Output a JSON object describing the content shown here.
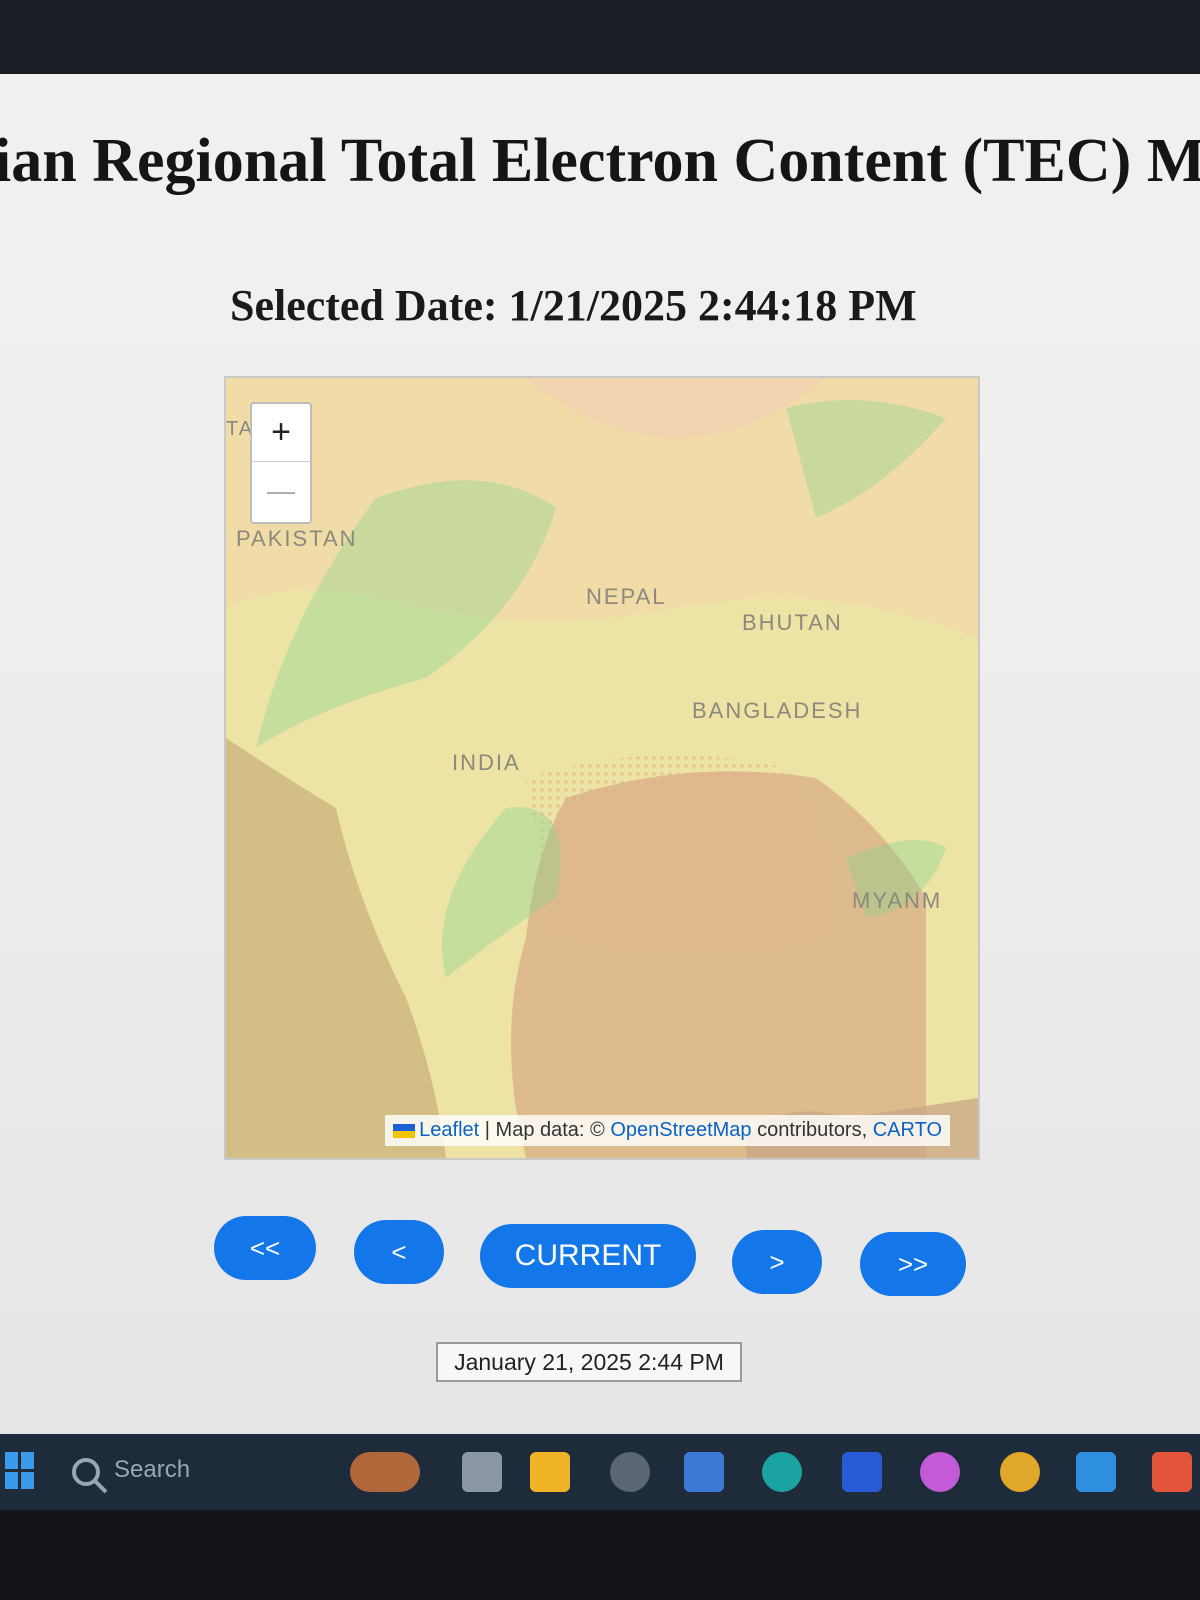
{
  "page": {
    "title": "ian Regional Total Electron Content (TEC) M",
    "selected_date_text": "Selected Date: 1/21/2025 2:44:18 PM"
  },
  "map": {
    "zoom_in_label": "+",
    "zoom_out_label": "—",
    "edge_label": "TA",
    "countries": [
      "PAKISTAN",
      "NEPAL",
      "BHUTAN",
      "BANGLADESH",
      "INDIA",
      "MYANM"
    ],
    "attribution": {
      "leaflet": "Leaflet",
      "separator": " | Map data: © ",
      "osm": "OpenStreetMap",
      "contributors": " contributors, ",
      "carto": "CARTO"
    }
  },
  "navigation": {
    "first": "<<",
    "prev": "<",
    "current": "CURRENT",
    "next": ">",
    "last": ">>"
  },
  "date_display": "January 21, 2025 2:44 PM",
  "taskbar": {
    "search_label": "Search",
    "icons": [
      "windows-start-icon",
      "search-icon",
      "fox-widget-icon",
      "task-view-icon",
      "file-explorer-icon",
      "settings-icon",
      "store-icon",
      "edge-icon",
      "app-icon",
      "copilot-icon",
      "chrome-icon",
      "vscode-icon",
      "brave-icon"
    ]
  },
  "colors": {
    "button_blue": "#1377ea",
    "map_base": "#ecdf9f",
    "taskbar": "#1d2b3a"
  }
}
